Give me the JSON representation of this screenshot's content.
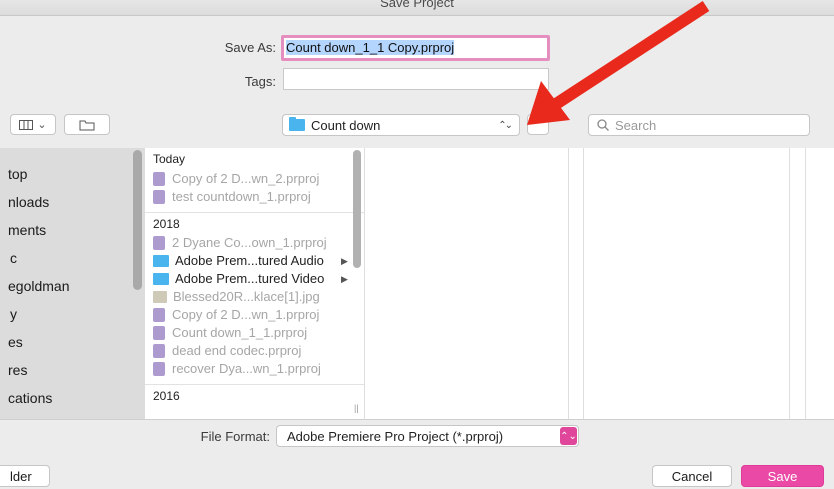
{
  "window": {
    "title": "Save Project"
  },
  "form": {
    "save_as_label": "Save As:",
    "save_as_value": "Count down_1_1 Copy.prproj",
    "tags_label": "Tags:",
    "tags_value": ""
  },
  "toolbar": {
    "view_icon": "columns-view-icon",
    "view_chevron": "⌄",
    "new_folder_icon": "new-folder-icon",
    "location": "Count down",
    "location_stepper": "⌃⌄",
    "search_placeholder": "Search"
  },
  "sidebar": {
    "items": [
      {
        "label": "top"
      },
      {
        "label": "nloads"
      },
      {
        "label": "ments"
      },
      {
        "label": "c"
      },
      {
        "label": "egoldman"
      },
      {
        "label": "y"
      },
      {
        "label": "es"
      },
      {
        "label": "res"
      },
      {
        "label": "cations"
      }
    ]
  },
  "browser": {
    "groups": [
      {
        "header": "Today",
        "files": [
          {
            "name": "Copy of 2 D...wn_2.prproj",
            "kind": "prproj",
            "dim": true
          },
          {
            "name": "test countdown_1.prproj",
            "kind": "prproj",
            "dim": true
          }
        ]
      },
      {
        "header": "2018",
        "files": [
          {
            "name": "2 Dyane Co...own_1.prproj",
            "kind": "prproj",
            "dim": true
          },
          {
            "name": "Adobe Prem...tured Audio",
            "kind": "folder",
            "dim": false,
            "arrow": "▶"
          },
          {
            "name": "Adobe Prem...tured Video",
            "kind": "folder",
            "dim": false,
            "arrow": "▶"
          },
          {
            "name": "Blessed20R...klace[1].jpg",
            "kind": "jpg",
            "dim": true
          },
          {
            "name": "Copy of 2 D...wn_1.prproj",
            "kind": "prproj",
            "dim": true
          },
          {
            "name": "Count down_1_1.prproj",
            "kind": "prproj",
            "dim": true
          },
          {
            "name": "dead end codec.prproj",
            "kind": "prproj",
            "dim": true
          },
          {
            "name": "recover Dya...wn_1.prproj",
            "kind": "prproj",
            "dim": true
          }
        ]
      },
      {
        "header": "2016",
        "files": []
      }
    ],
    "resize_glyph": "||"
  },
  "footer": {
    "file_format_label": "File Format:",
    "file_format_value": "Adobe Premiere Pro Project (*.prproj)",
    "file_format_stepper": "⌃⌄",
    "new_folder_label": "lder",
    "cancel_label": "Cancel",
    "save_label": "Save"
  },
  "annotation": {
    "color": "#e8291c"
  },
  "colors": {
    "accent": "#ea4aa5",
    "folder": "#4ab4ee",
    "focus_ring": "#e48fbf"
  }
}
